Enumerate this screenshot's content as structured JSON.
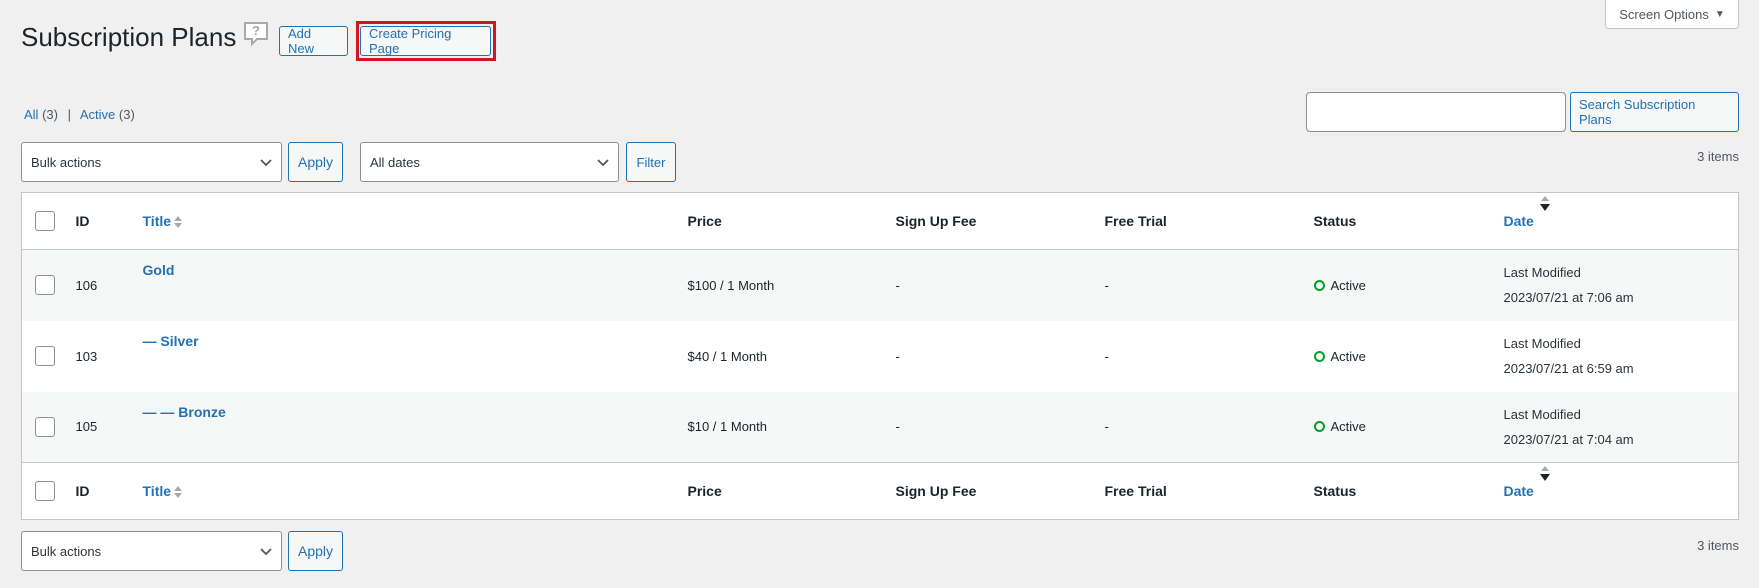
{
  "header": {
    "title": "Subscription Plans",
    "add_new_label": "Add New",
    "create_pricing_label": "Create Pricing Page",
    "screen_options_label": "Screen Options"
  },
  "views": {
    "all_label": "All",
    "all_count": "(3)",
    "active_label": "Active",
    "active_count": "(3)"
  },
  "search": {
    "value": "",
    "button_label": "Search Subscription Plans"
  },
  "tablenav_top": {
    "bulk_actions_value": "Bulk actions",
    "apply_label": "Apply",
    "dates_value": "All dates",
    "filter_label": "Filter",
    "items_count": "3 items"
  },
  "tablenav_bottom": {
    "bulk_actions_value": "Bulk actions",
    "apply_label": "Apply",
    "items_count": "3 items"
  },
  "table": {
    "columns": {
      "id": "ID",
      "title": "Title",
      "price": "Price",
      "signup_fee": "Sign Up Fee",
      "free_trial": "Free Trial",
      "status": "Status",
      "date": "Date"
    },
    "rows": [
      {
        "id": "106",
        "title": "Gold",
        "price": "$100 / 1 Month",
        "signup_fee": "-",
        "free_trial": "-",
        "status": "Active",
        "date_label": "Last Modified",
        "date_value": "2023/07/21 at 7:06 am"
      },
      {
        "id": "103",
        "title": "— Silver",
        "price": "$40 / 1 Month",
        "signup_fee": "-",
        "free_trial": "-",
        "status": "Active",
        "date_label": "Last Modified",
        "date_value": "2023/07/21 at 6:59 am"
      },
      {
        "id": "105",
        "title": "— — Bronze",
        "price": "$10 / 1 Month",
        "signup_fee": "-",
        "free_trial": "-",
        "status": "Active",
        "date_label": "Last Modified",
        "date_value": "2023/07/21 at 7:04 am"
      }
    ]
  },
  "colors": {
    "accent": "#2271b1",
    "highlight": "#d6131f",
    "status_active": "#00a32a",
    "background": "#f0f0f1"
  }
}
